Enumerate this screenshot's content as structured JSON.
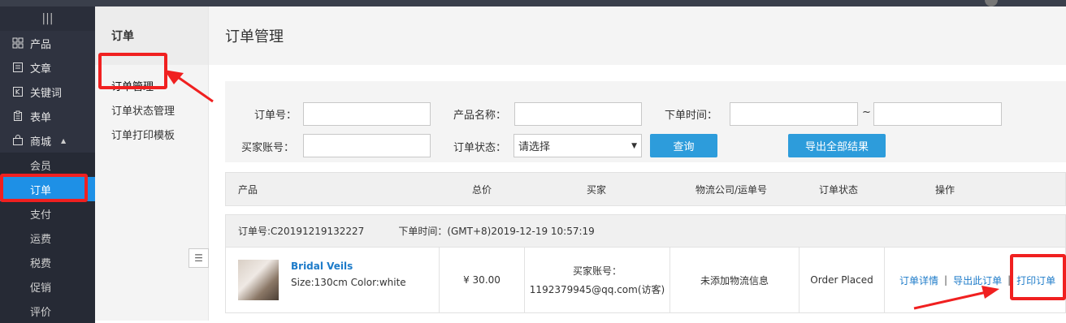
{
  "nav": {
    "items": [
      {
        "label": "产品",
        "icon": "grid-icon"
      },
      {
        "label": "文章",
        "icon": "document-icon"
      },
      {
        "label": "关键词",
        "icon": "keyword-icon"
      },
      {
        "label": "表单",
        "icon": "clipboard-icon"
      },
      {
        "label": "商城",
        "icon": "shopping-bag-icon"
      }
    ],
    "sub_items": [
      "会员",
      "订单",
      "支付",
      "运费",
      "税费",
      "促销",
      "评价"
    ],
    "active_sub": "订单"
  },
  "panel2": {
    "header": "订单",
    "links": [
      "订单管理",
      "订单状态管理",
      "订单打印模板"
    ]
  },
  "main": {
    "title": "订单管理",
    "filter": {
      "order_no_label": "订单号：",
      "product_name_label": "产品名称：",
      "order_time_label": "下单时间：",
      "range_sep": "~",
      "buyer_label": "买家账号：",
      "status_label": "订单状态：",
      "status_value": "请选择",
      "query_button": "查询",
      "export_button": "导出全部结果"
    },
    "columns": [
      "产品",
      "总价",
      "买家",
      "物流公司/运单号",
      "订单状态",
      "操作"
    ],
    "order": {
      "order_no": "订单号:C20191219132227",
      "order_time": "下单时间：(GMT+8)2019-12-19 10:57:19",
      "product_name": "Bridal Veils",
      "product_attrs": "Size:130cm  Color:white",
      "total": "¥ 30.00",
      "buyer_line1": "买家账号：",
      "buyer_line2": "1192379945@qq.com(访客)",
      "logistics": "未添加物流信息",
      "status": "Order Placed",
      "op_detail": "订单详情",
      "op_export": "导出此订单",
      "op_print": "打印订单",
      "separator": "|"
    }
  },
  "colors": {
    "nav_bg": "#2f3340",
    "active_blue": "#1e90e6",
    "button_blue": "#2d9cdb",
    "link_blue": "#1d7bc9",
    "annotation_red": "#f02020"
  }
}
